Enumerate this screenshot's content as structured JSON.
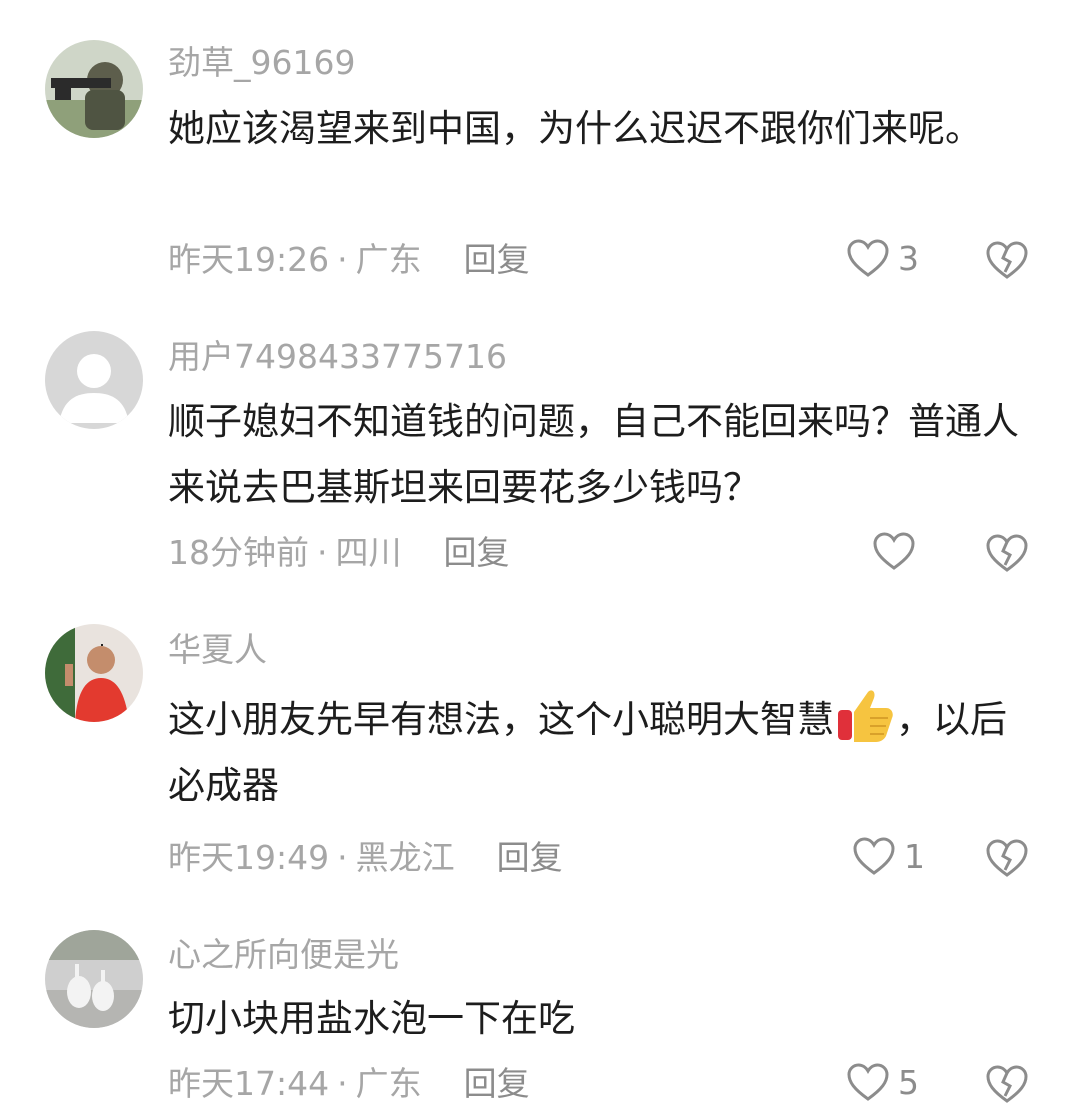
{
  "comments": [
    {
      "username": "劲草_96169",
      "text": "她应该渴望来到中国，为什么迟迟不跟你们来呢。",
      "time": "昨天19:26",
      "location": "广东",
      "reply": "回复",
      "likes": "3"
    },
    {
      "username": "用户7498433775716",
      "text": "顺子媳妇不知道钱的问题，自己不能回来吗？普通人来说去巴基斯坦来回要花多少钱吗？",
      "time": "18分钟前",
      "location": "四川",
      "reply": "回复",
      "likes": ""
    },
    {
      "username": "华夏人",
      "text_before": "这小朋友先早有想法，这个小聪明大智慧",
      "text_after": "，以后必成器",
      "emoji": "thumbs-up-icon",
      "time": "昨天19:49",
      "location": "黑龙江",
      "reply": "回复",
      "likes": "1"
    },
    {
      "username": "心之所向便是光",
      "text": "切小块用盐水泡一下在吃",
      "time": "昨天17:44",
      "location": "广东",
      "reply": "回复",
      "likes": "5"
    }
  ],
  "separator": "·"
}
